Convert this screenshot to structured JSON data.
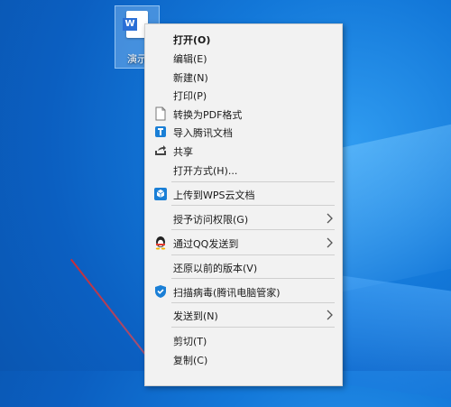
{
  "desktop": {
    "icon_label": "演示",
    "icon_badge": "W"
  },
  "menu": {
    "items": [
      {
        "label": "打开(O)"
      },
      {
        "label": "编辑(E)"
      },
      {
        "label": "新建(N)"
      },
      {
        "label": "打印(P)"
      },
      {
        "label": "转换为PDF格式"
      },
      {
        "label": "导入腾讯文档"
      },
      {
        "label": "共享"
      },
      {
        "label": "打开方式(H)..."
      },
      {
        "label": "上传到WPS云文档"
      },
      {
        "label": "授予访问权限(G)"
      },
      {
        "label": "通过QQ发送到"
      },
      {
        "label": "还原以前的版本(V)"
      },
      {
        "label": "扫描病毒(腾讯电脑管家)"
      },
      {
        "label": "发送到(N)"
      },
      {
        "label": "剪切(T)"
      },
      {
        "label": "复制(C)"
      }
    ]
  },
  "icons": {
    "pdf": "document-icon",
    "tencent_docs": "tencent-docs-icon",
    "share": "share-icon",
    "wps_cloud": "wps-cloud-icon",
    "qq": "qq-penguin-icon",
    "tencent_guard": "tencent-pc-manager-shield-icon",
    "chevron": "chevron-right-icon"
  },
  "colors": {
    "menu_bg": "#f2f2f2",
    "separator": "#cfcfcf",
    "accent_blue": "#1a7fd6",
    "qq_red": "#e63a2e"
  }
}
